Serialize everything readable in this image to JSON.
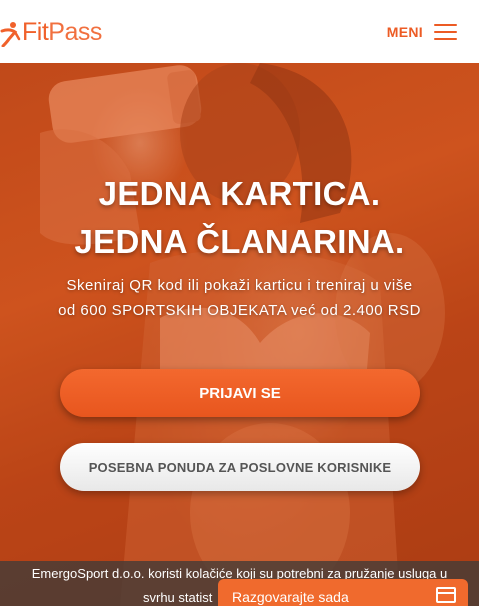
{
  "header": {
    "logo_fit": "Fit",
    "logo_pass": "Pass",
    "menu_label": "MENI"
  },
  "hero": {
    "headline_line1": "JEDNA KARTICA.",
    "headline_line2": "JEDNA ČLANARINA.",
    "subtext_line1": "Skeniraj QR kod ili pokaži karticu i treniraj u više",
    "subtext_line2": "od 600 SPORTSKIH OBJEKATA već od 2.400 RSD",
    "primary_button": "PRIJAVI SE",
    "secondary_button": "POSEBNA PONUDA ZA POSLOVNE KORISNIKE"
  },
  "cookie_bar": {
    "text_line1": "EmergoSport d.o.o. koristi kolačiće koji su potrebni za pružanje usluga u",
    "text_line2": "svrhu statist"
  },
  "chat": {
    "label": "Razgovarajte sada",
    "icon": "chat-window-icon"
  },
  "colors": {
    "brand_orange": "#ec5b24",
    "hero_tint": "#c24a1a",
    "chat_orange": "#f06a2d"
  }
}
